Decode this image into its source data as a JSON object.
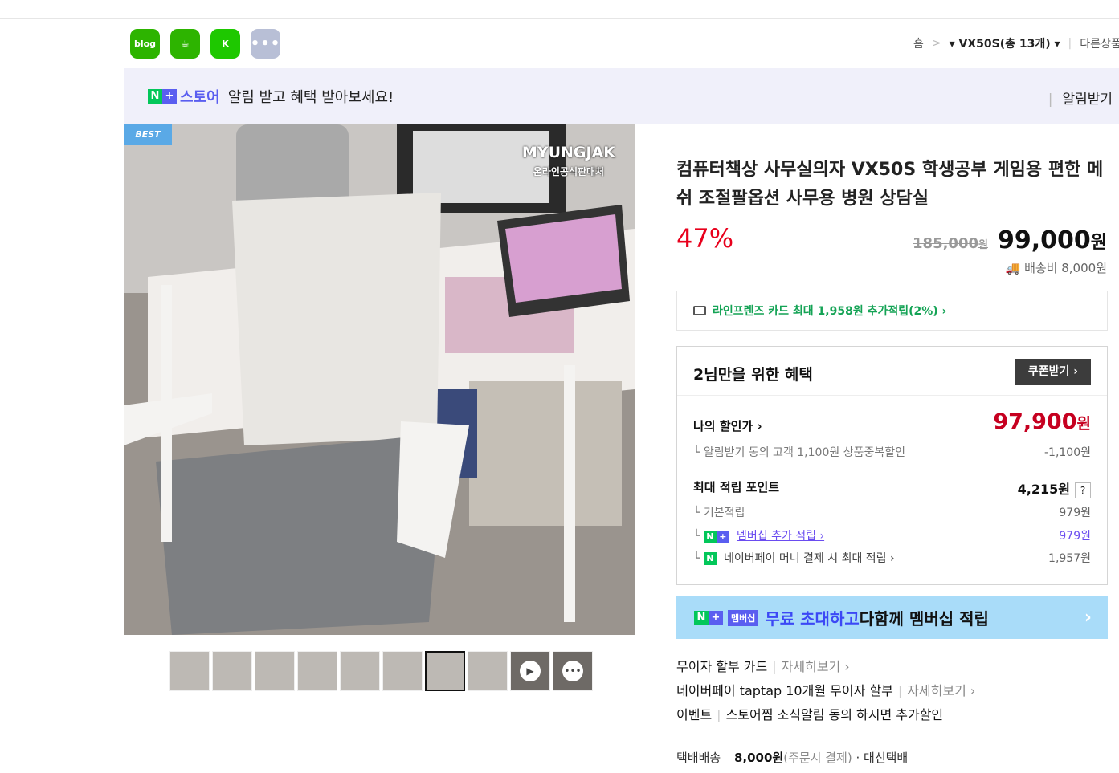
{
  "share": {
    "blog": "blog",
    "cafe": "cafe",
    "story": "kstory",
    "more": "•••"
  },
  "breadcrumb": {
    "home": "홈",
    "sep": ">",
    "current": "▾ VX50S(총 13개) ▾",
    "other": "다른상품보기"
  },
  "notice": {
    "brand_n": "N",
    "brand_plus": "+",
    "store": "스토어",
    "text": "알림 받고 혜택 받아보세요!",
    "right": "알림받기"
  },
  "photo": {
    "badge": "BEST",
    "watermark": "MYUNGJAK",
    "watermark_sub": "온라인공식판매처"
  },
  "thumbs": {
    "video_icon": "▶",
    "talk_icon": "•••"
  },
  "product": {
    "title": "컴퓨터책상 사무실의자 VX50S 학생공부 게임용 편한 메쉬 조절팔옵션 사무용 병원 상담실",
    "discount_rate": "47%",
    "original_price": "185,000",
    "original_won": "원",
    "price": "99,000",
    "price_won": "원",
    "shipping": "배송비 8,000원"
  },
  "card": {
    "text": "라인프렌즈 카드 최대 1,958원 추가적립(2%) ›"
  },
  "benefit": {
    "title": "2님만을 위한 혜택",
    "coupon": "쿠폰받기 ›",
    "my_price_label": "나의 할인가 ›",
    "my_price": "97,900",
    "my_price_won": "원",
    "my_price_sub": "└  알림받기 동의 고객 1,100원 상품중복할인",
    "my_price_minus": "-1,100원",
    "points_label": "최대 적립 포인트",
    "points_value": "4,215원",
    "points_q": "?",
    "base_label": "└  기본적립",
    "base_value": "979원",
    "membership_label": "멤버십 추가 적립 ›",
    "membership_value": "979원",
    "npay_label": "네이버페이 머니 결제 시 최대 적립 ›",
    "npay_value": "1,957원"
  },
  "banner": {
    "n": "N",
    "plus": "+",
    "mb": "멤버십",
    "highlight": "무료 초대하고",
    "text": "다함께 멤버십 적립",
    "chev": "›"
  },
  "info": {
    "row1_label": "무이자 할부 카드",
    "row1_link": "자세히보기 ›",
    "row2_label": "네이버페이 taptap 10개월 무이자 할부",
    "row2_link": "자세히보기 ›",
    "row3_label": "이벤트",
    "row3_text": "스토어찜 소식알림 동의 하시면 추가할인"
  },
  "delivery": {
    "label": "택배배송",
    "price": "8,000원",
    "note": "(주문시 결제)",
    "extra": "· 대신택배"
  }
}
